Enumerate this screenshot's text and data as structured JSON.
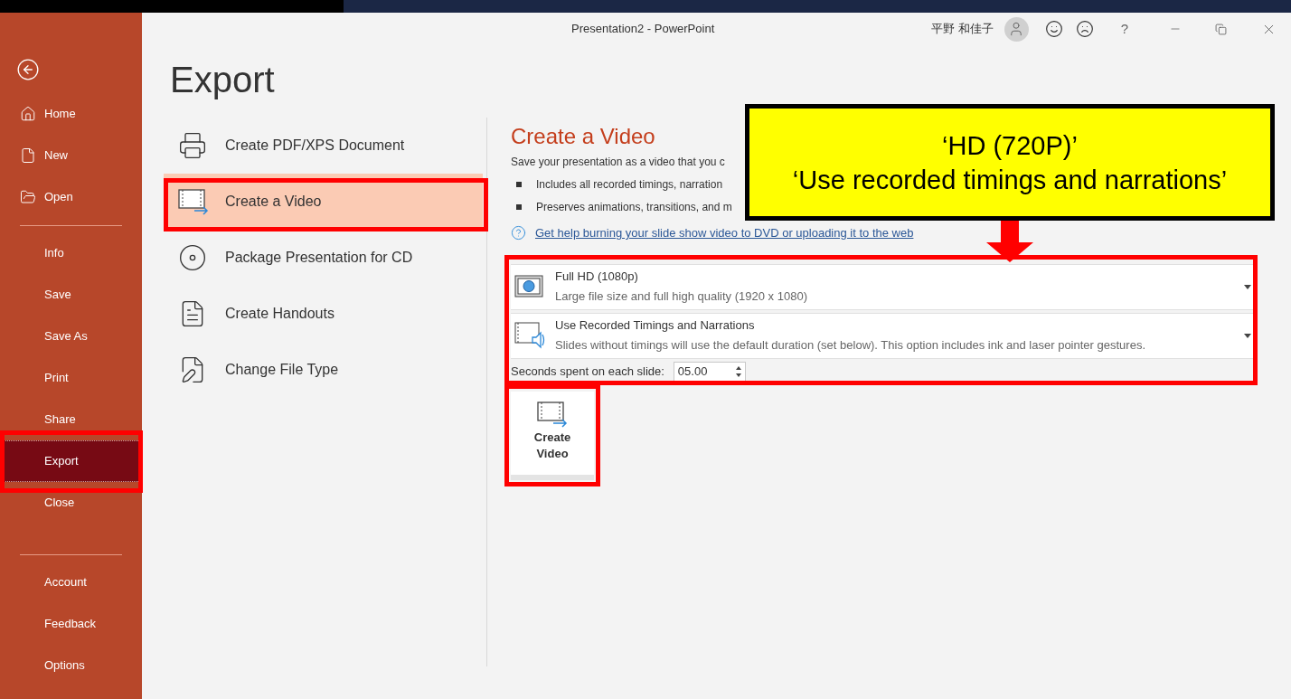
{
  "window": {
    "title": "Presentation2  -  PowerPoint",
    "user": "平野 和佳子",
    "help": "?"
  },
  "sidebar": {
    "groups": [
      {
        "items": [
          {
            "label": "Home",
            "kind": "home",
            "selected": false
          },
          {
            "label": "New",
            "kind": "new",
            "selected": false
          },
          {
            "label": "Open",
            "kind": "open",
            "selected": false
          }
        ]
      },
      {
        "items": [
          {
            "label": "Info",
            "kind": "plain",
            "selected": false
          },
          {
            "label": "Save",
            "kind": "plain",
            "selected": false
          },
          {
            "label": "Save As",
            "kind": "plain",
            "selected": false
          },
          {
            "label": "Print",
            "kind": "plain",
            "selected": false
          },
          {
            "label": "Share",
            "kind": "plain",
            "selected": false
          },
          {
            "label": "Export",
            "kind": "plain",
            "selected": true
          },
          {
            "label": "Close",
            "kind": "plain",
            "selected": false
          }
        ]
      },
      {
        "items": [
          {
            "label": "Account",
            "kind": "plain",
            "selected": false
          },
          {
            "label": "Feedback",
            "kind": "plain",
            "selected": false
          },
          {
            "label": "Options",
            "kind": "plain",
            "selected": false
          }
        ]
      }
    ]
  },
  "page": {
    "title": "Export",
    "options": [
      {
        "label": "Create PDF/XPS Document",
        "kind": "pdf",
        "selected": false
      },
      {
        "label": "Create a Video",
        "kind": "video",
        "selected": true
      },
      {
        "label": "Package Presentation for CD",
        "kind": "cd",
        "selected": false
      },
      {
        "label": "Create Handouts",
        "kind": "handouts",
        "selected": false
      },
      {
        "label": "Change File Type",
        "kind": "filetype",
        "selected": false
      }
    ]
  },
  "video": {
    "title": "Create a Video",
    "description": "Save your presentation as a video that you c",
    "bullets": [
      "Includes all recorded timings, narration",
      "Preserves animations, transitions, and m"
    ],
    "help_link": "Get help burning your slide show video to DVD or uploading it to the web",
    "dropdowns": [
      {
        "kind": "quality",
        "title": "Full HD (1080p)",
        "subtitle": "Large file size and full high quality (1920 x 1080)"
      },
      {
        "kind": "timings",
        "title": "Use Recorded Timings and Narrations",
        "subtitle": "Slides without timings will use the default duration (set below). This option includes ink and laser pointer gestures."
      }
    ],
    "seconds_label": "Seconds spent on each slide:",
    "seconds_value": "05.00",
    "create_button": "Create Video"
  },
  "callout": {
    "lines": [
      "‘HD (720P)’",
      "‘Use recorded timings and narrations’"
    ]
  }
}
